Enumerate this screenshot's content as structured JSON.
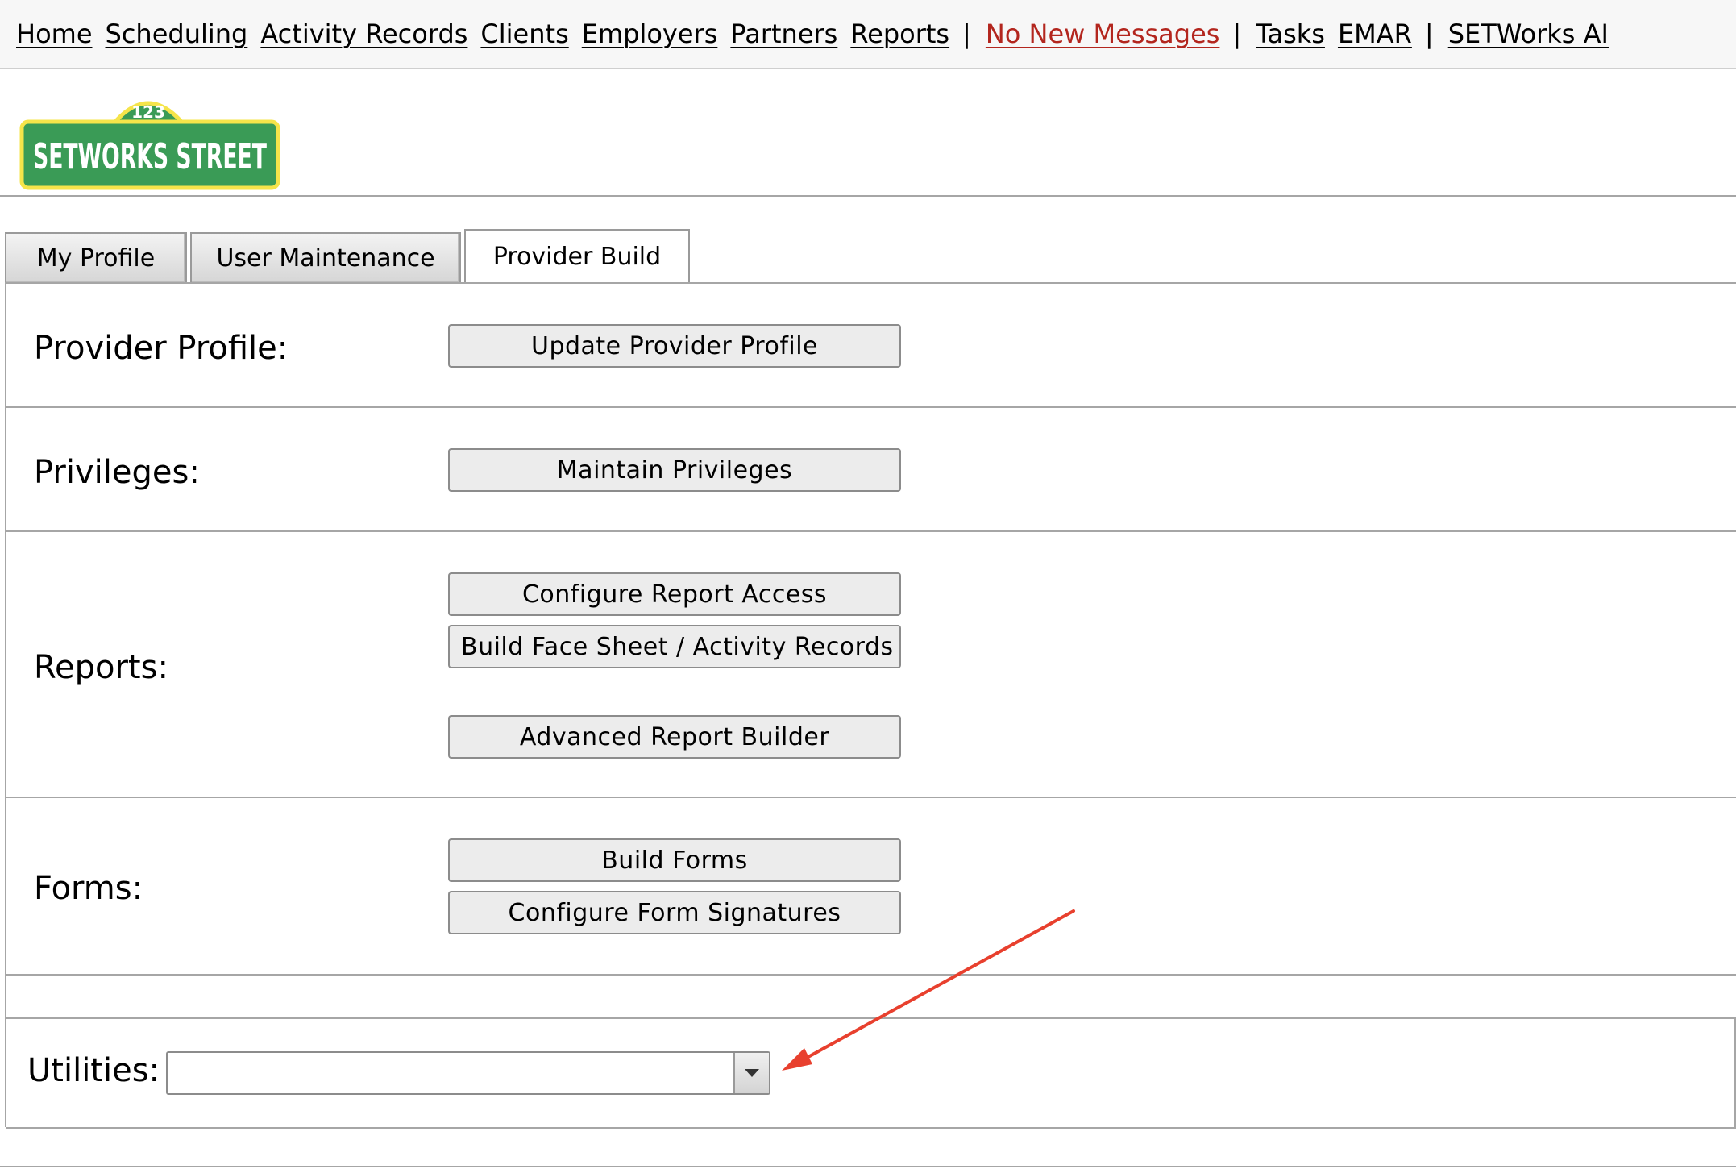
{
  "nav": {
    "items": [
      "Home",
      "Scheduling",
      "Activity Records",
      "Clients",
      "Employers",
      "Partners",
      "Reports"
    ],
    "separator": "|",
    "messages": "No New Messages",
    "items2": [
      "Tasks",
      "EMAR"
    ],
    "ai": "SETWorks AI"
  },
  "logo": {
    "number": "123",
    "text": "SETWORKS STREET",
    "colors": {
      "green": "#3a9b56",
      "yellow": "#f5e44a"
    }
  },
  "tabs": [
    {
      "label": "My Profile",
      "active": false
    },
    {
      "label": "User Maintenance",
      "active": false
    },
    {
      "label": "Provider Build",
      "active": true
    }
  ],
  "sections": {
    "provider_profile": {
      "label": "Provider Profile:",
      "buttons": [
        "Update Provider Profile"
      ]
    },
    "privileges": {
      "label": "Privileges:",
      "buttons": [
        "Maintain Privileges"
      ]
    },
    "reports": {
      "label": "Reports:",
      "buttons": [
        "Configure Report Access",
        "Build Face Sheet / Activity Records Re",
        "Advanced Report Builder"
      ]
    },
    "forms": {
      "label": "Forms:",
      "buttons": [
        "Build Forms",
        "Configure Form Signatures"
      ]
    }
  },
  "utilities": {
    "label": "Utilities:",
    "selected_value": ""
  },
  "colors": {
    "message_link": "#b3261e",
    "annotation_arrow": "#e8402e"
  }
}
